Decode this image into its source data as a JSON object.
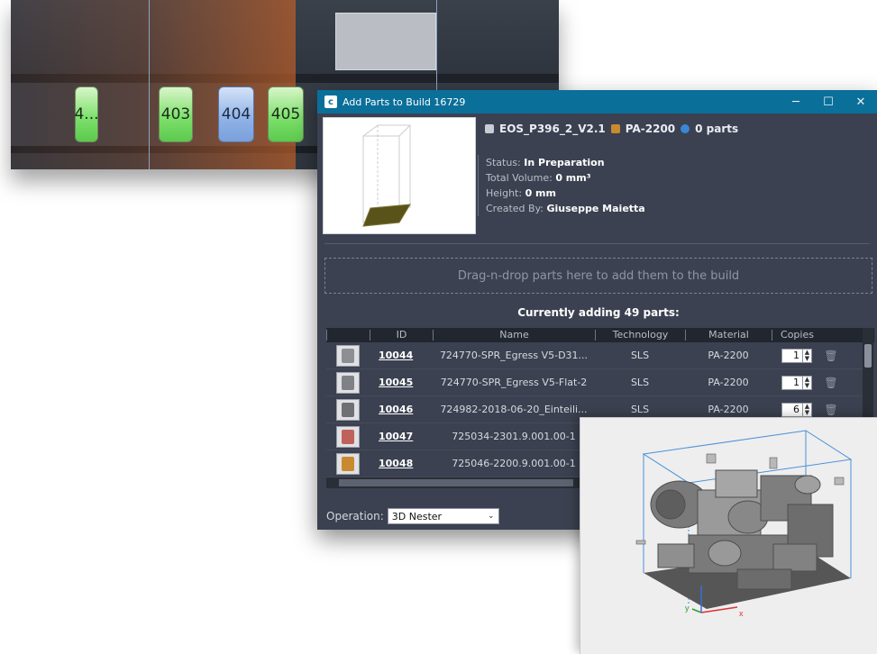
{
  "timeline": {
    "chips": [
      {
        "label": "4...",
        "color": "green"
      },
      {
        "label": "403",
        "color": "green"
      },
      {
        "label": "404",
        "color": "blue"
      },
      {
        "label": "405",
        "color": "green"
      }
    ]
  },
  "dialog": {
    "title": "Add Parts to Build 16729",
    "controls": {
      "minimize": "─",
      "maximize": "☐",
      "close": "✕"
    },
    "machine": "EOS_P396_2_V2.1",
    "material": "PA-2200",
    "parts_count": "0 parts",
    "status_label": "Status:",
    "status_value": "In Preparation",
    "volume_label": "Total Volume:",
    "volume_value": "0 mm³",
    "height_label": "Height:",
    "height_value": "0 mm",
    "created_label": "Created By:",
    "created_value": "Giuseppe Maietta",
    "dropzone_text": "Drag-n-drop parts here to add them to the build",
    "adding_text": "Currently adding 49 parts:",
    "columns": {
      "id": "ID",
      "name": "Name",
      "technology": "Technology",
      "material": "Material",
      "copies": "Copies"
    },
    "rows": [
      {
        "id": "10044",
        "name": "724770-SPR_Egress V5-D31...",
        "technology": "SLS",
        "material": "PA-2200",
        "copies": "1",
        "thumb_color": "#8d8f93"
      },
      {
        "id": "10045",
        "name": "724770-SPR_Egress V5-Flat-2",
        "technology": "SLS",
        "material": "PA-2200",
        "copies": "1",
        "thumb_color": "#7f8186"
      },
      {
        "id": "10046",
        "name": "724982-2018-06-20_Einteili...",
        "technology": "SLS",
        "material": "PA-2200",
        "copies": "6",
        "thumb_color": "#6e7074"
      },
      {
        "id": "10047",
        "name": "725034-2301.9.001.00-1",
        "technology": "",
        "material": "",
        "copies": "",
        "thumb_color": "#c0625c"
      },
      {
        "id": "10048",
        "name": "725046-2200.9.001.00-1",
        "technology": "",
        "material": "",
        "copies": "",
        "thumb_color": "#c98a2f"
      }
    ],
    "operation_label": "Operation:",
    "operation_value": "3D Nester"
  },
  "nest_view": {
    "axis_x": "x",
    "axis_y": "y"
  }
}
